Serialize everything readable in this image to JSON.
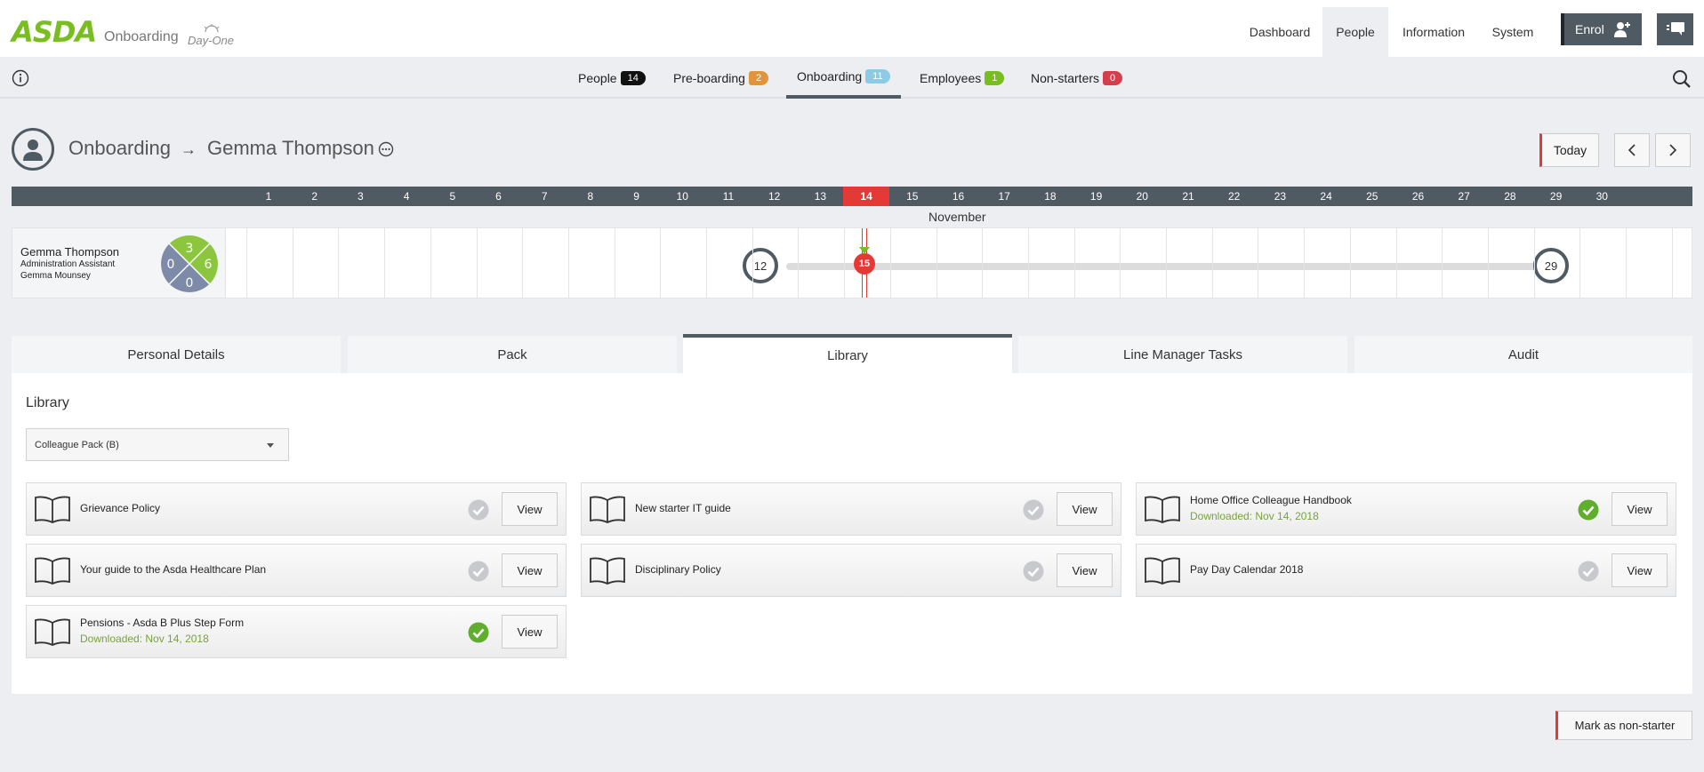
{
  "header": {
    "logo": "ASDA",
    "brand_sub": "Onboarding",
    "dayone": "Day-One",
    "nav": [
      "Dashboard",
      "People",
      "Information",
      "System"
    ],
    "active_nav": "People",
    "enrol_label": "Enrol"
  },
  "subnav": {
    "tabs": [
      {
        "label": "People",
        "count": "14",
        "color": "#111111"
      },
      {
        "label": "Pre-boarding",
        "count": "2",
        "color": "#e0953d"
      },
      {
        "label": "Onboarding",
        "count": "11",
        "color": "#8ccbe6"
      },
      {
        "label": "Employees",
        "count": "1",
        "color": "#78be20"
      },
      {
        "label": "Non-starters",
        "count": "0",
        "color": "#d43f4e"
      }
    ],
    "active": "Onboarding"
  },
  "title": {
    "section": "Onboarding",
    "arrow": "→",
    "person": "Gemma Thompson",
    "today_label": "Today"
  },
  "timeline": {
    "days": [
      "1",
      "2",
      "3",
      "4",
      "5",
      "6",
      "7",
      "8",
      "9",
      "10",
      "11",
      "12",
      "13",
      "14",
      "15",
      "16",
      "17",
      "18",
      "19",
      "20",
      "21",
      "22",
      "23",
      "24",
      "25",
      "26",
      "27",
      "28",
      "29",
      "30"
    ],
    "today": "14",
    "month": "November",
    "person": {
      "name": "Gemma Thompson",
      "role": "Administration Assistant",
      "manager": "Gemma Mounsey",
      "pie": {
        "top": "3",
        "right": "6",
        "bottom": "0",
        "left": "0"
      }
    },
    "start_node": "12",
    "today_node": "15",
    "end_node": "29"
  },
  "tabs": [
    "Personal Details",
    "Pack",
    "Library",
    "Line Manager Tasks",
    "Audit"
  ],
  "active_tab": "Library",
  "library": {
    "title": "Library",
    "select_value": "Colleague Pack (B)",
    "view_label": "View",
    "items": [
      {
        "title": "Grievance Policy",
        "downloaded": "",
        "done": false
      },
      {
        "title": "New starter IT guide",
        "downloaded": "",
        "done": false
      },
      {
        "title": "Home Office Colleague Handbook",
        "downloaded": "Downloaded: Nov 14, 2018",
        "done": true
      },
      {
        "title": "Your guide to the Asda Healthcare Plan",
        "downloaded": "",
        "done": false
      },
      {
        "title": "Disciplinary Policy",
        "downloaded": "",
        "done": false
      },
      {
        "title": "Pay Day Calendar 2018",
        "downloaded": "",
        "done": false
      },
      {
        "title": "Pensions - Asda B Plus Step Form",
        "downloaded": "Downloaded: Nov 14, 2018",
        "done": true
      }
    ]
  },
  "footer": {
    "nonstarter_label": "Mark as non-starter"
  },
  "colors": {
    "brand": "#78be20",
    "dark": "#4f5a62",
    "alert": "#e53935"
  }
}
